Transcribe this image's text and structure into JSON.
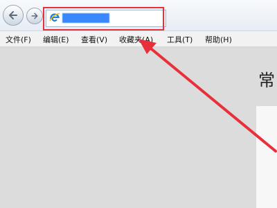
{
  "toolbar": {
    "back_icon": "back-arrow-icon",
    "forward_icon": "forward-arrow-icon",
    "address": {
      "browser_icon": "ie-logo-icon",
      "url": ""
    }
  },
  "menubar": {
    "items": [
      {
        "label": "文件(F)"
      },
      {
        "label": "编辑(E)"
      },
      {
        "label": "查看(V)"
      },
      {
        "label": "收藏夹(A)"
      },
      {
        "label": "工具(T)"
      },
      {
        "label": "帮助(H)"
      }
    ]
  },
  "content": {
    "heading_partial": "常"
  },
  "annotation": {
    "highlight_color": "#e8303a",
    "arrow_color": "#e8303a"
  }
}
